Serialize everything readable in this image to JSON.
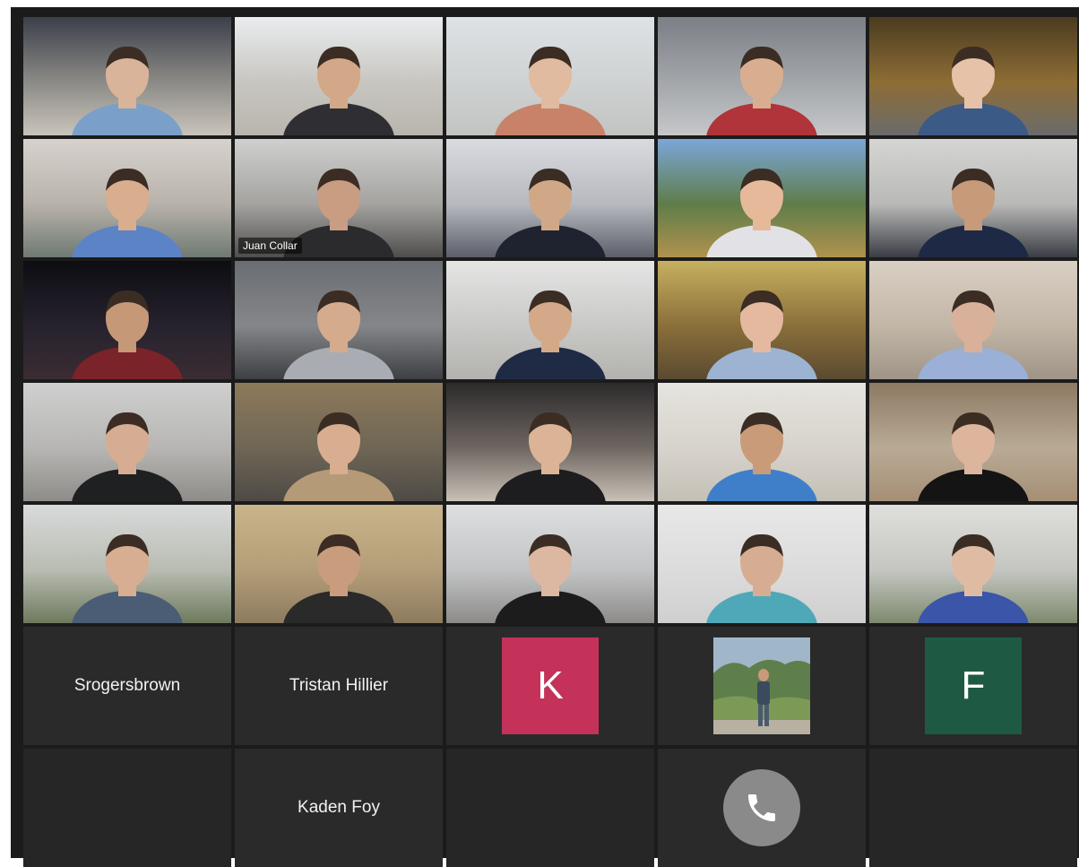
{
  "meeting": {
    "participants": [
      {
        "kind": "video",
        "label": "",
        "skin": "#d9b49a",
        "shirt": "#7aa0c9",
        "top": "#3a3f4a",
        "mid": "#8c8a86",
        "bot": "#c9c4bb"
      },
      {
        "kind": "video",
        "label": "",
        "skin": "#d2a888",
        "shirt": "#2f2f33",
        "top": "#e9ecef",
        "mid": "#c8c6c1",
        "bot": "#b9b5ae"
      },
      {
        "kind": "video",
        "label": "",
        "skin": "#e0bba0",
        "shirt": "#c9826a",
        "top": "#dde2e6",
        "mid": "#cfd2d2",
        "bot": "#c2c4c2"
      },
      {
        "kind": "video",
        "label": "",
        "skin": "#d9ae90",
        "shirt": "#b0343a",
        "top": "#7b7f86",
        "mid": "#a3a6aa",
        "bot": "#c5c7c9"
      },
      {
        "kind": "video",
        "label": "",
        "skin": "#e6c2a8",
        "shirt": "#3c5a86",
        "top": "#4a3b20",
        "mid": "#8e6d35",
        "bot": "#6b6b6b"
      },
      {
        "kind": "video",
        "label": "",
        "skin": "#d8ae8f",
        "shirt": "#5d83c7",
        "top": "#d7d2cd",
        "mid": "#b8b2ab",
        "bot": "#6f7a72"
      },
      {
        "kind": "video",
        "label": "Juan Collar",
        "skin": "#c99d82",
        "shirt": "#2b2b2e",
        "top": "#cfd0cf",
        "mid": "#a4a3a0",
        "bot": "#4f4e4d"
      },
      {
        "kind": "video",
        "label": "",
        "skin": "#d0a888",
        "shirt": "#1f2330",
        "top": "#d9dbe0",
        "mid": "#b7b9bf",
        "bot": "#5b5f69"
      },
      {
        "kind": "video",
        "label": "",
        "skin": "#e5b99a",
        "shirt": "#e2e2e6",
        "top": "#7ba6d9",
        "mid": "#5f7d4a",
        "bot": "#b0924d"
      },
      {
        "kind": "video",
        "label": "",
        "skin": "#c79a7a",
        "shirt": "#1e2a45",
        "top": "#d5d5d3",
        "mid": "#b9b9b7",
        "bot": "#3a3d45"
      },
      {
        "kind": "video",
        "label": "",
        "skin": "#c59878",
        "shirt": "#7a2328",
        "top": "#0d0d12",
        "mid": "#26222e",
        "bot": "#3b2c32"
      },
      {
        "kind": "video",
        "label": "",
        "skin": "#d4ab8d",
        "shirt": "#a9adb3",
        "top": "#6a6e72",
        "mid": "#85868a",
        "bot": "#3d3f42"
      },
      {
        "kind": "video",
        "label": "",
        "skin": "#d3a98a",
        "shirt": "#1f2b45",
        "top": "#e4e5e4",
        "mid": "#c9c9c7",
        "bot": "#b3b2ae"
      },
      {
        "kind": "video",
        "label": "",
        "skin": "#e4b9a0",
        "shirt": "#9cb3d1",
        "top": "#c6b060",
        "mid": "#8a6f3a",
        "bot": "#5b4a31"
      },
      {
        "kind": "video",
        "label": "",
        "skin": "#d9b09a",
        "shirt": "#9ab0d6",
        "top": "#d9cfc3",
        "mid": "#c2b6a7",
        "bot": "#9f9486"
      },
      {
        "kind": "video",
        "label": "",
        "skin": "#d6ad92",
        "shirt": "#1f2022",
        "top": "#cfcfcf",
        "mid": "#b7b6b4",
        "bot": "#8e8c88"
      },
      {
        "kind": "video",
        "label": "",
        "skin": "#d8ad90",
        "shirt": "#b59a78",
        "top": "#8d7a5a",
        "mid": "#6f6656",
        "bot": "#4e4a45"
      },
      {
        "kind": "video",
        "label": "",
        "skin": "#dbb497",
        "shirt": "#1d1d20",
        "top": "#2c2a2b",
        "mid": "#6e6660",
        "bot": "#c9c1b7"
      },
      {
        "kind": "video",
        "label": "",
        "skin": "#c99b79",
        "shirt": "#3f7fc9",
        "top": "#e6e4df",
        "mid": "#d7d3cc",
        "bot": "#c5c0b6"
      },
      {
        "kind": "video",
        "label": "",
        "skin": "#ddb59c",
        "shirt": "#141414",
        "top": "#8c7a63",
        "mid": "#b9aa96",
        "bot": "#a58f75"
      },
      {
        "kind": "video",
        "label": "",
        "skin": "#d7ae92",
        "shirt": "#4b5d75",
        "top": "#d9dadb",
        "mid": "#b9bcb2",
        "bot": "#6e7a5e"
      },
      {
        "kind": "video",
        "label": "",
        "skin": "#c99c7d",
        "shirt": "#2a2a2a",
        "top": "#c9b48a",
        "mid": "#b39e78",
        "bot": "#8d7b5f"
      },
      {
        "kind": "video",
        "label": "",
        "skin": "#dcb7a2",
        "shirt": "#1c1c1c",
        "top": "#dedfe0",
        "mid": "#c3c4c5",
        "bot": "#8c8b89"
      },
      {
        "kind": "video",
        "label": "",
        "skin": "#d6ad92",
        "shirt": "#4fa8b7",
        "top": "#e8e8e8",
        "mid": "#dcdcdc",
        "bot": "#cfcfcf"
      },
      {
        "kind": "video",
        "label": "",
        "skin": "#e0bba4",
        "shirt": "#3b55a8",
        "top": "#dfe0dc",
        "mid": "#c5c6c2",
        "bot": "#7d8a6e"
      },
      {
        "kind": "name",
        "label": "Srogersbrown"
      },
      {
        "kind": "name",
        "label": "Tristan Hillier"
      },
      {
        "kind": "initial",
        "label": "K",
        "color": "#c4325a"
      },
      {
        "kind": "photo",
        "label": ""
      },
      {
        "kind": "initial",
        "label": "F",
        "color": "#1e5a43"
      },
      {
        "kind": "empty",
        "label": ""
      },
      {
        "kind": "name",
        "label": "Kaden Foy"
      },
      {
        "kind": "empty",
        "label": ""
      },
      {
        "kind": "phone",
        "label": ""
      },
      {
        "kind": "empty",
        "label": ""
      }
    ]
  }
}
